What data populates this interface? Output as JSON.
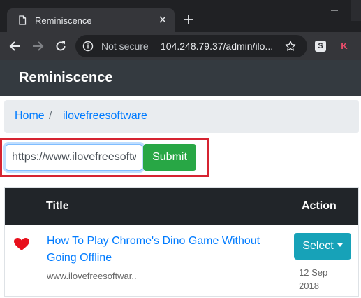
{
  "browser": {
    "tab_title": "Reminiscence",
    "security_label": "Not secure",
    "url": "104.248.79.37/admin/ilo...",
    "extension_s": "S",
    "extension_k": "K"
  },
  "navbar": {
    "brand": "Reminiscence"
  },
  "breadcrumb": {
    "home": "Home",
    "separator": "/",
    "current": "ilovefreesoftware"
  },
  "form": {
    "url_value": "https://www.ilovefreesoftware.com/",
    "submit_label": "Submit"
  },
  "table": {
    "headers": {
      "title": "Title",
      "action": "Action"
    },
    "rows": [
      {
        "icon": "heart-icon",
        "title": "How To Play Chrome's Dino Game Without Going Offline",
        "source": "www.ilovefreesoftwar..",
        "action_label": "Select",
        "date": "12 Sep 2018"
      }
    ]
  },
  "colors": {
    "navbar": "#343a40",
    "link": "#007bff",
    "submit": "#28a745",
    "select": "#17a2b8",
    "heart": "#e8101c",
    "highlight": "#d62431"
  }
}
